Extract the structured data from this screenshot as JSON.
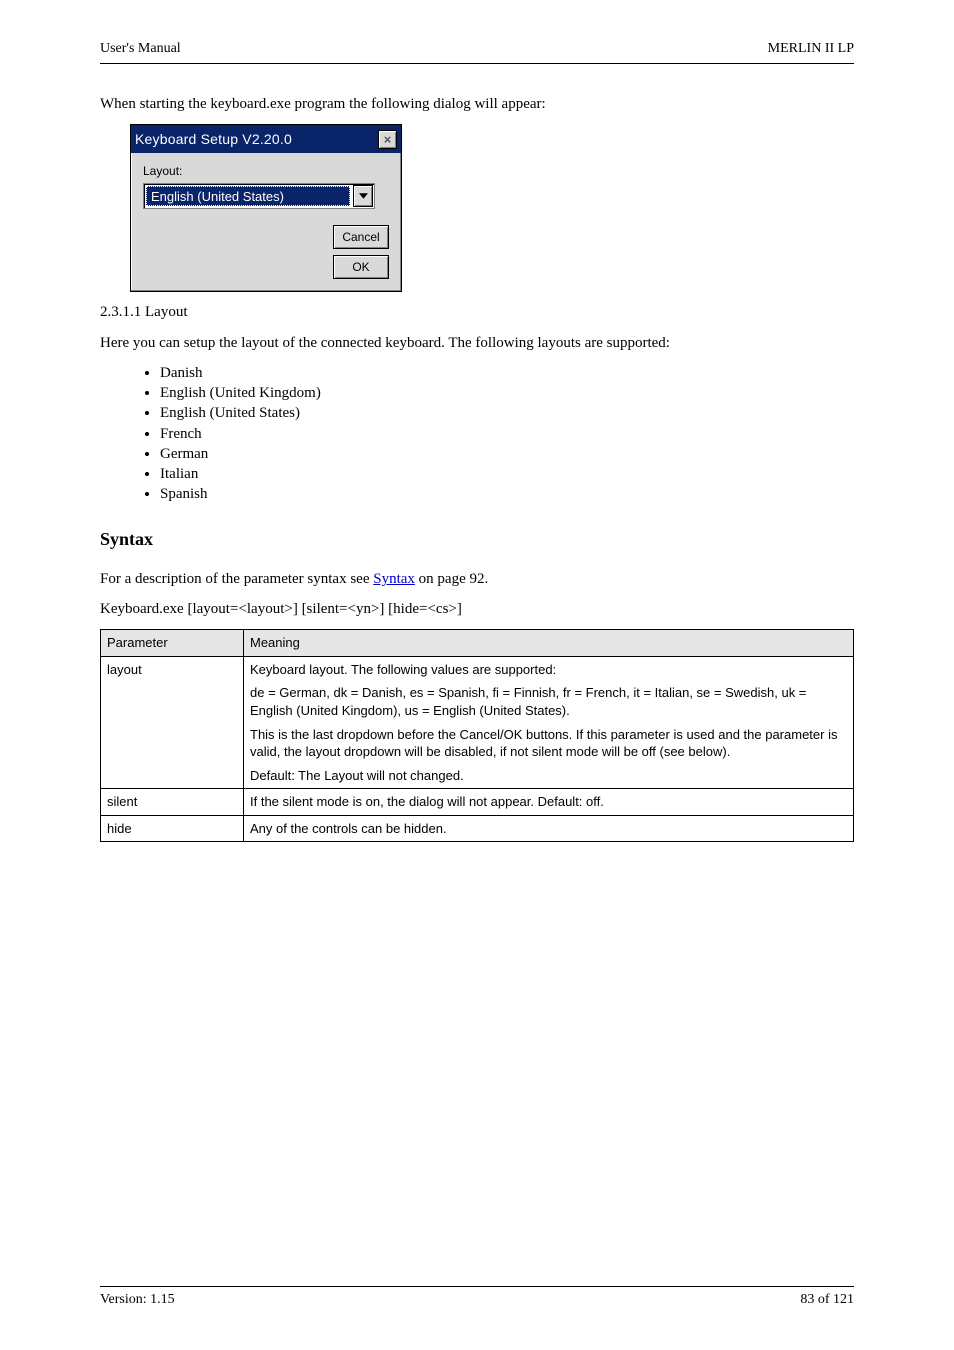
{
  "header": {
    "left": "User's Manual",
    "right": "MERLIN II LP"
  },
  "intro": "When starting the keyboard.exe program the following dialog will appear:",
  "dialog": {
    "title": "Keyboard Setup  V2.20.0",
    "label": "Layout:",
    "selected": "English (United States)",
    "cancel": "Cancel",
    "ok": "OK"
  },
  "section_line": "2.3.1.1 Layout",
  "section_body": "Here you can setup the layout of the connected keyboard. The following layouts are supported:",
  "layouts": [
    "Danish",
    "English (United Kingdom)",
    "English (United States)",
    "French",
    "German",
    "Italian",
    "Spanish"
  ],
  "syntax": {
    "heading": "Syntax",
    "line_before_link": "For a description of the parameter syntax see ",
    "link_text": "Syntax",
    "line_after_link": " on page 92.",
    "command": "Keyboard.exe [layout=<layout>] [silent=<yn>] [hide=<cs>]"
  },
  "table": {
    "headers": [
      "Parameter",
      "Meaning"
    ],
    "rows": [
      {
        "param": "layout",
        "meaning": [
          "Keyboard layout. The following values are supported:",
          "de = German, dk = Danish, es = Spanish, fi = Finnish, fr = French, it = Italian, se = Swedish, uk = English (United Kingdom), us = English (United States).",
          "This is the last dropdown before the Cancel/OK buttons. If this parameter is used and the parameter is valid, the layout dropdown will be disabled, if not silent mode will be off (see below).",
          "Default: The Layout will not changed."
        ]
      },
      {
        "param": "silent",
        "meaning": [
          "If the silent mode is on, the dialog will not appear. Default: off."
        ]
      },
      {
        "param": "hide",
        "meaning": [
          "Any of the controls can be hidden."
        ]
      }
    ]
  },
  "footer": {
    "left": "Version: 1.15",
    "right": "83 of 121"
  }
}
